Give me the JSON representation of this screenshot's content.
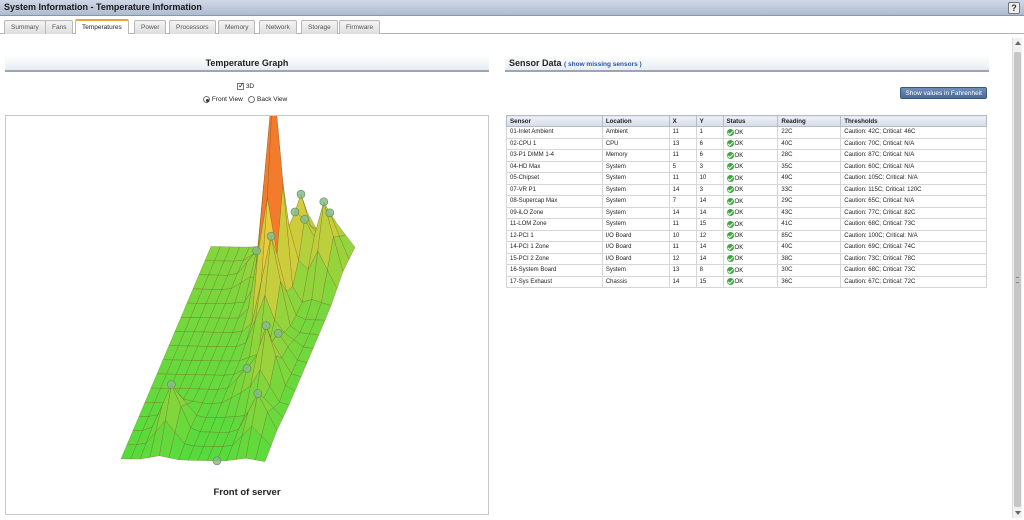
{
  "window": {
    "title": "System Information - Temperature Information",
    "help_label": "?"
  },
  "tabs": [
    "Summary",
    "Fans",
    "Temperatures",
    "Power",
    "Processors",
    "Memory",
    "Network",
    "Storage",
    "Firmware"
  ],
  "active_tab": "Temperatures",
  "graph": {
    "title": "Temperature Graph",
    "checkbox_3d_label": "3D",
    "checkbox_3d_checked": true,
    "front_view_label": "Front View",
    "back_view_label": "Back View",
    "selected_view": "Front View",
    "caption": "Front of server"
  },
  "sensor_panel": {
    "title": "Sensor Data",
    "missing_link": "( show missing sensors )",
    "fahrenheit_button": "Show values in Fahrenheit",
    "columns": [
      "Sensor",
      "Location",
      "X",
      "Y",
      "Status",
      "Reading",
      "Thresholds"
    ],
    "status_icon": "check-circle-icon",
    "rows": [
      [
        "01-Inlet Ambient",
        "Ambient",
        "11",
        "1",
        "OK",
        "22C",
        "Caution: 42C; Critical: 46C"
      ],
      [
        "02-CPU 1",
        "CPU",
        "13",
        "6",
        "OK",
        "40C",
        "Caution: 70C; Critical: N/A"
      ],
      [
        "03-P1 DIMM 1-4",
        "Memory",
        "11",
        "6",
        "OK",
        "28C",
        "Caution: 87C; Critical: N/A"
      ],
      [
        "04-HD Max",
        "System",
        "5",
        "3",
        "OK",
        "35C",
        "Caution: 60C; Critical: N/A"
      ],
      [
        "05-Chipset",
        "System",
        "11",
        "10",
        "OK",
        "49C",
        "Caution: 105C; Critical: N/A"
      ],
      [
        "07-VR P1",
        "System",
        "14",
        "3",
        "OK",
        "33C",
        "Caution: 115C; Critical: 120C"
      ],
      [
        "08-Supercap Max",
        "System",
        "7",
        "14",
        "OK",
        "29C",
        "Caution: 65C; Critical: N/A"
      ],
      [
        "09-iLO Zone",
        "System",
        "14",
        "14",
        "OK",
        "43C",
        "Caution: 77C; Critical: 82C"
      ],
      [
        "11-LOM Zone",
        "System",
        "11",
        "15",
        "OK",
        "41C",
        "Caution: 68C; Critical: 73C"
      ],
      [
        "12-PCI 1",
        "I/O Board",
        "10",
        "12",
        "OK",
        "85C",
        "Caution: 100C; Critical: N/A"
      ],
      [
        "14-PCI 1 Zone",
        "I/O Board",
        "11",
        "14",
        "OK",
        "40C",
        "Caution: 69C; Critical: 74C"
      ],
      [
        "15-PCI 2 Zone",
        "I/O Board",
        "12",
        "14",
        "OK",
        "38C",
        "Caution: 73C; Critical: 78C"
      ],
      [
        "16-System Board",
        "System",
        "13",
        "8",
        "OK",
        "30C",
        "Caution: 68C; Critical: 73C"
      ],
      [
        "17-Sys Exhaust",
        "Chassis",
        "14",
        "15",
        "OK",
        "36C",
        "Caution: 67C; Critical: 72C"
      ]
    ]
  },
  "colors": {
    "cool": "#44dd44",
    "mid": "#f0a030",
    "hot": "#dd1111",
    "sensor_marker": "#88bb88",
    "link": "#2a57a6"
  }
}
